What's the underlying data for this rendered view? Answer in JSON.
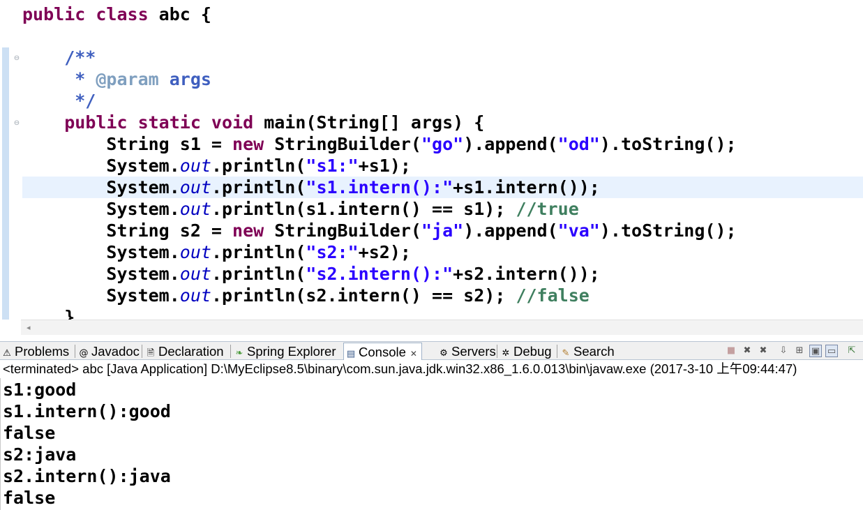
{
  "editor": {
    "fold_markers": [
      "⊖",
      "⊖"
    ],
    "scroll_left_arrow": "◂",
    "lines": [
      [
        {
          "t": "public class",
          "c": "kw"
        },
        {
          "t": " abc {",
          "c": ""
        }
      ],
      [],
      [
        {
          "t": "    /**",
          "c": "cm"
        }
      ],
      [
        {
          "t": "     * ",
          "c": "cm"
        },
        {
          "t": "@param",
          "c": "tag"
        },
        {
          "t": " args",
          "c": "cm"
        }
      ],
      [
        {
          "t": "     */",
          "c": "cm"
        }
      ],
      [
        {
          "t": "    ",
          "c": ""
        },
        {
          "t": "public static void",
          "c": "kw"
        },
        {
          "t": " main(String[] args) {",
          "c": ""
        }
      ],
      [
        {
          "t": "        String s1 = ",
          "c": ""
        },
        {
          "t": "new",
          "c": "kw"
        },
        {
          "t": " StringBuilder(",
          "c": ""
        },
        {
          "t": "\"go\"",
          "c": "str"
        },
        {
          "t": ").append(",
          "c": ""
        },
        {
          "t": "\"od\"",
          "c": "str"
        },
        {
          "t": ").toString();",
          "c": ""
        }
      ],
      [
        {
          "t": "        System.",
          "c": ""
        },
        {
          "t": "out",
          "c": "fld"
        },
        {
          "t": ".println(",
          "c": ""
        },
        {
          "t": "\"s1:\"",
          "c": "str"
        },
        {
          "t": "+s1);",
          "c": ""
        }
      ],
      [
        {
          "t": "        System.",
          "c": ""
        },
        {
          "t": "out",
          "c": "fld"
        },
        {
          "t": ".println(",
          "c": ""
        },
        {
          "t": "\"s1.intern():\"",
          "c": "str"
        },
        {
          "t": "+s1.intern());",
          "c": ""
        }
      ],
      [
        {
          "t": "        System.",
          "c": ""
        },
        {
          "t": "out",
          "c": "fld"
        },
        {
          "t": ".println(s1.intern() == s1); ",
          "c": ""
        },
        {
          "t": "//true",
          "c": "lc"
        }
      ],
      [
        {
          "t": "        String s2 = ",
          "c": ""
        },
        {
          "t": "new",
          "c": "kw"
        },
        {
          "t": " StringBuilder(",
          "c": ""
        },
        {
          "t": "\"ja\"",
          "c": "str"
        },
        {
          "t": ").append(",
          "c": ""
        },
        {
          "t": "\"va\"",
          "c": "str"
        },
        {
          "t": ").toString();",
          "c": ""
        }
      ],
      [
        {
          "t": "        System.",
          "c": ""
        },
        {
          "t": "out",
          "c": "fld"
        },
        {
          "t": ".println(",
          "c": ""
        },
        {
          "t": "\"s2:\"",
          "c": "str"
        },
        {
          "t": "+s2);",
          "c": ""
        }
      ],
      [
        {
          "t": "        System.",
          "c": ""
        },
        {
          "t": "out",
          "c": "fld"
        },
        {
          "t": ".println(",
          "c": ""
        },
        {
          "t": "\"s2.intern():\"",
          "c": "str"
        },
        {
          "t": "+s2.intern());",
          "c": ""
        }
      ],
      [
        {
          "t": "        System.",
          "c": ""
        },
        {
          "t": "out",
          "c": "fld"
        },
        {
          "t": ".println(s2.intern() == s2); ",
          "c": ""
        },
        {
          "t": "//false",
          "c": "lc"
        }
      ],
      [
        {
          "t": "    }",
          "c": ""
        }
      ]
    ]
  },
  "tabs": {
    "problems": {
      "icon": "⚠",
      "label": "Problems"
    },
    "javadoc": {
      "icon": "@",
      "label": "Javadoc"
    },
    "declaration": {
      "icon": "🗎",
      "label": "Declaration"
    },
    "spring": {
      "icon": "❧",
      "label": "Spring Explorer"
    },
    "console": {
      "icon": "▤",
      "label": "Console",
      "close": "✕"
    },
    "servers": {
      "icon": "⚙",
      "label": "Servers"
    },
    "debug": {
      "icon": "✲",
      "label": "Debug"
    },
    "search": {
      "icon": "✎",
      "label": "Search"
    }
  },
  "toolbar_icons": {
    "terminate": "■",
    "remove": "✖",
    "remove_all": "✖",
    "scroll_lock": "⇩",
    "pin": "⊞",
    "display": "▣",
    "open": "▭",
    "minimize": "▬",
    "maximize": "⇱"
  },
  "console": {
    "header": "<terminated> abc [Java Application] D:\\MyEclipse8.5\\binary\\com.sun.java.jdk.win32.x86_1.6.0.013\\bin\\javaw.exe (2017-3-10 上午09:44:47)",
    "output": [
      "s1:good",
      "s1.intern():good",
      "false",
      "s2:java",
      "s2.intern():java",
      "false"
    ]
  }
}
